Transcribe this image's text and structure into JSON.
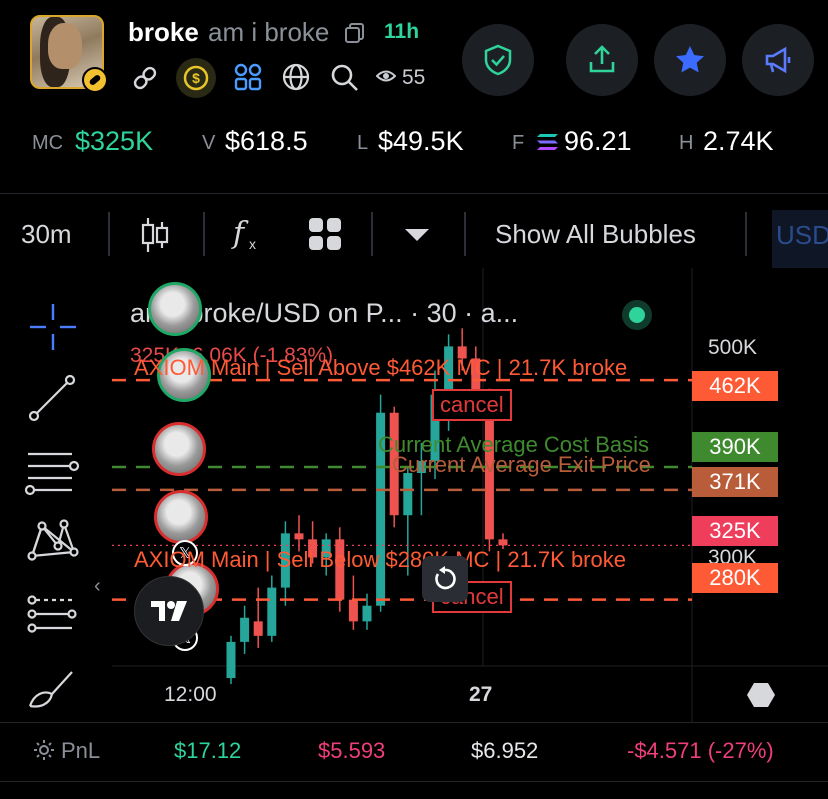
{
  "header": {
    "title": "broke",
    "subtitle": "am i broke",
    "age": "11h",
    "views": "55"
  },
  "stats": [
    {
      "label": "MC",
      "value": "$325K"
    },
    {
      "label": "V",
      "value": "$618.5"
    },
    {
      "label": "L",
      "value": "$49.5K"
    },
    {
      "label": "F",
      "value": "96.21"
    },
    {
      "label": "H",
      "value": "2.74K"
    }
  ],
  "toolbar": {
    "interval": "30m",
    "bubbles": "Show All Bubbles",
    "currency": "USD"
  },
  "chart": {
    "title": "am i broke/USD on P... · 30 · a...",
    "ohlc": "325K  -6.06K (-1.83%)",
    "y_labels": [
      "500K",
      "300K"
    ],
    "x_labels": [
      "12:00",
      "27"
    ],
    "sell_above": "AXIOM Main | Sell Above $462K MC | 21.7K broke",
    "sell_below": "AXIOM Main | Sell Below $280K MC | 21.7K broke",
    "cancel": "cancel",
    "avg_cost": "Current Average Cost Basis",
    "avg_exit": "Current Average Exit Price",
    "tags": [
      "462K",
      "390K",
      "371K",
      "325K",
      "280K"
    ],
    "colors": {
      "up": "#26a69a",
      "down": "#ef5350",
      "sell_line": "#ff5a36",
      "cost": "#3f8a2e",
      "exit": "#b85c3a"
    }
  },
  "chart_data": {
    "type": "candlestick",
    "title": "am i broke/USD on P... · 30 · a...",
    "y_unit": "K (market cap)",
    "ylim": [
      225,
      555
    ],
    "x_ticks": [
      "12:00",
      "27"
    ],
    "series": [
      {
        "o": 215,
        "h": 250,
        "l": 210,
        "c": 245
      },
      {
        "o": 245,
        "h": 275,
        "l": 235,
        "c": 265
      },
      {
        "o": 262,
        "h": 290,
        "l": 240,
        "c": 250
      },
      {
        "o": 250,
        "h": 300,
        "l": 245,
        "c": 290
      },
      {
        "o": 290,
        "h": 345,
        "l": 275,
        "c": 335
      },
      {
        "o": 335,
        "h": 350,
        "l": 320,
        "c": 330
      },
      {
        "o": 330,
        "h": 345,
        "l": 310,
        "c": 315
      },
      {
        "o": 315,
        "h": 335,
        "l": 300,
        "c": 330
      },
      {
        "o": 330,
        "h": 340,
        "l": 270,
        "c": 280
      },
      {
        "o": 280,
        "h": 300,
        "l": 255,
        "c": 262
      },
      {
        "o": 262,
        "h": 285,
        "l": 255,
        "c": 275
      },
      {
        "o": 275,
        "h": 450,
        "l": 270,
        "c": 435
      },
      {
        "o": 435,
        "h": 440,
        "l": 340,
        "c": 350
      },
      {
        "o": 350,
        "h": 390,
        "l": 300,
        "c": 385
      },
      {
        "o": 385,
        "h": 410,
        "l": 350,
        "c": 395
      },
      {
        "o": 395,
        "h": 470,
        "l": 380,
        "c": 450
      },
      {
        "o": 450,
        "h": 500,
        "l": 420,
        "c": 490
      },
      {
        "o": 490,
        "h": 505,
        "l": 470,
        "c": 480
      },
      {
        "o": 480,
        "h": 490,
        "l": 430,
        "c": 440
      },
      {
        "o": 440,
        "h": 455,
        "l": 320,
        "c": 330
      },
      {
        "o": 330,
        "h": 335,
        "l": 322,
        "c": 325
      }
    ],
    "price_lines": [
      {
        "label": "Sell Above",
        "value": 462
      },
      {
        "label": "Current Average Cost Basis",
        "value": 390
      },
      {
        "label": "Current Average Exit Price",
        "value": 371
      },
      {
        "label": "Current",
        "value": 325
      },
      {
        "label": "Sell Below",
        "value": 280
      }
    ]
  },
  "bottom": {
    "pnl_label": "PnL",
    "values": [
      "$17.12",
      "$5.593",
      "$6.952",
      "-$4.571 (-27%)"
    ]
  }
}
